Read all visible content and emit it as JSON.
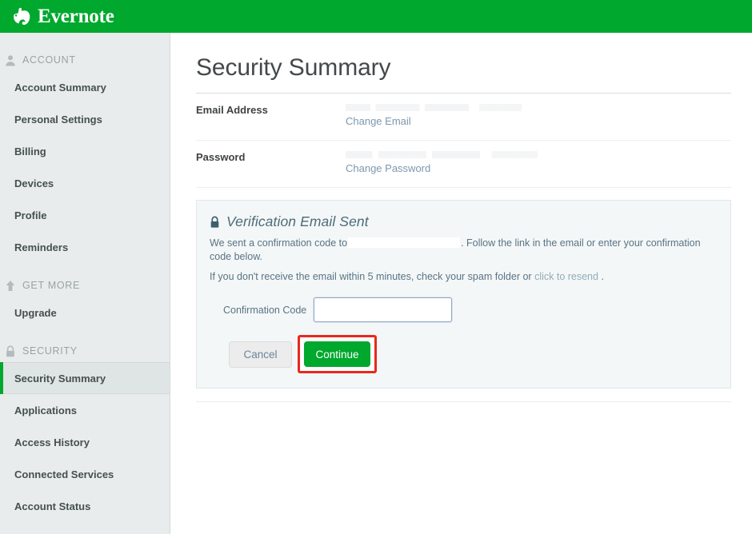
{
  "topbar": {
    "brand_name": "Evernote",
    "brand_icon": "elephant-logo-icon",
    "bg_color": "#00a82d"
  },
  "sidebar": {
    "sections": [
      {
        "label": "ACCOUNT",
        "icon": "person-icon",
        "items": [
          {
            "label": "Account Summary",
            "active": false
          },
          {
            "label": "Personal Settings",
            "active": false
          },
          {
            "label": "Billing",
            "active": false
          },
          {
            "label": "Devices",
            "active": false
          },
          {
            "label": "Profile",
            "active": false
          },
          {
            "label": "Reminders",
            "active": false
          }
        ]
      },
      {
        "label": "GET MORE",
        "icon": "up-arrow-icon",
        "items": [
          {
            "label": "Upgrade",
            "active": false
          }
        ]
      },
      {
        "label": "SECURITY",
        "icon": "lock-icon",
        "items": [
          {
            "label": "Security Summary",
            "active": true
          },
          {
            "label": "Applications",
            "active": false
          },
          {
            "label": "Access History",
            "active": false
          },
          {
            "label": "Connected Services",
            "active": false
          },
          {
            "label": "Account Status",
            "active": false
          }
        ]
      }
    ],
    "active_accent_color": "#00a82d"
  },
  "main": {
    "page_title": "Security Summary",
    "rows": [
      {
        "label": "Email Address",
        "value_redacted": true,
        "link_label": "Change Email"
      },
      {
        "label": "Password",
        "value_redacted": true,
        "link_label": "Change Password"
      }
    ],
    "verification_panel": {
      "icon": "lock-icon",
      "title": "Verification Email Sent",
      "body_prefix": "We sent a confirmation code to",
      "body_suffix": ". Follow the link in the email or enter your confirmation code below.",
      "recipient_redacted": true,
      "spam_notice_prefix": "If you don't receive the email within 5 minutes, check your spam folder or",
      "resend_link_label": "click to resend",
      "spam_notice_suffix": ".",
      "code_label": "Confirmation Code",
      "code_value": "",
      "code_placeholder": "",
      "cancel_label": "Cancel",
      "continue_label": "Continue",
      "continue_highlight_color": "#e8291c",
      "continue_button_color": "#00a82d"
    }
  }
}
